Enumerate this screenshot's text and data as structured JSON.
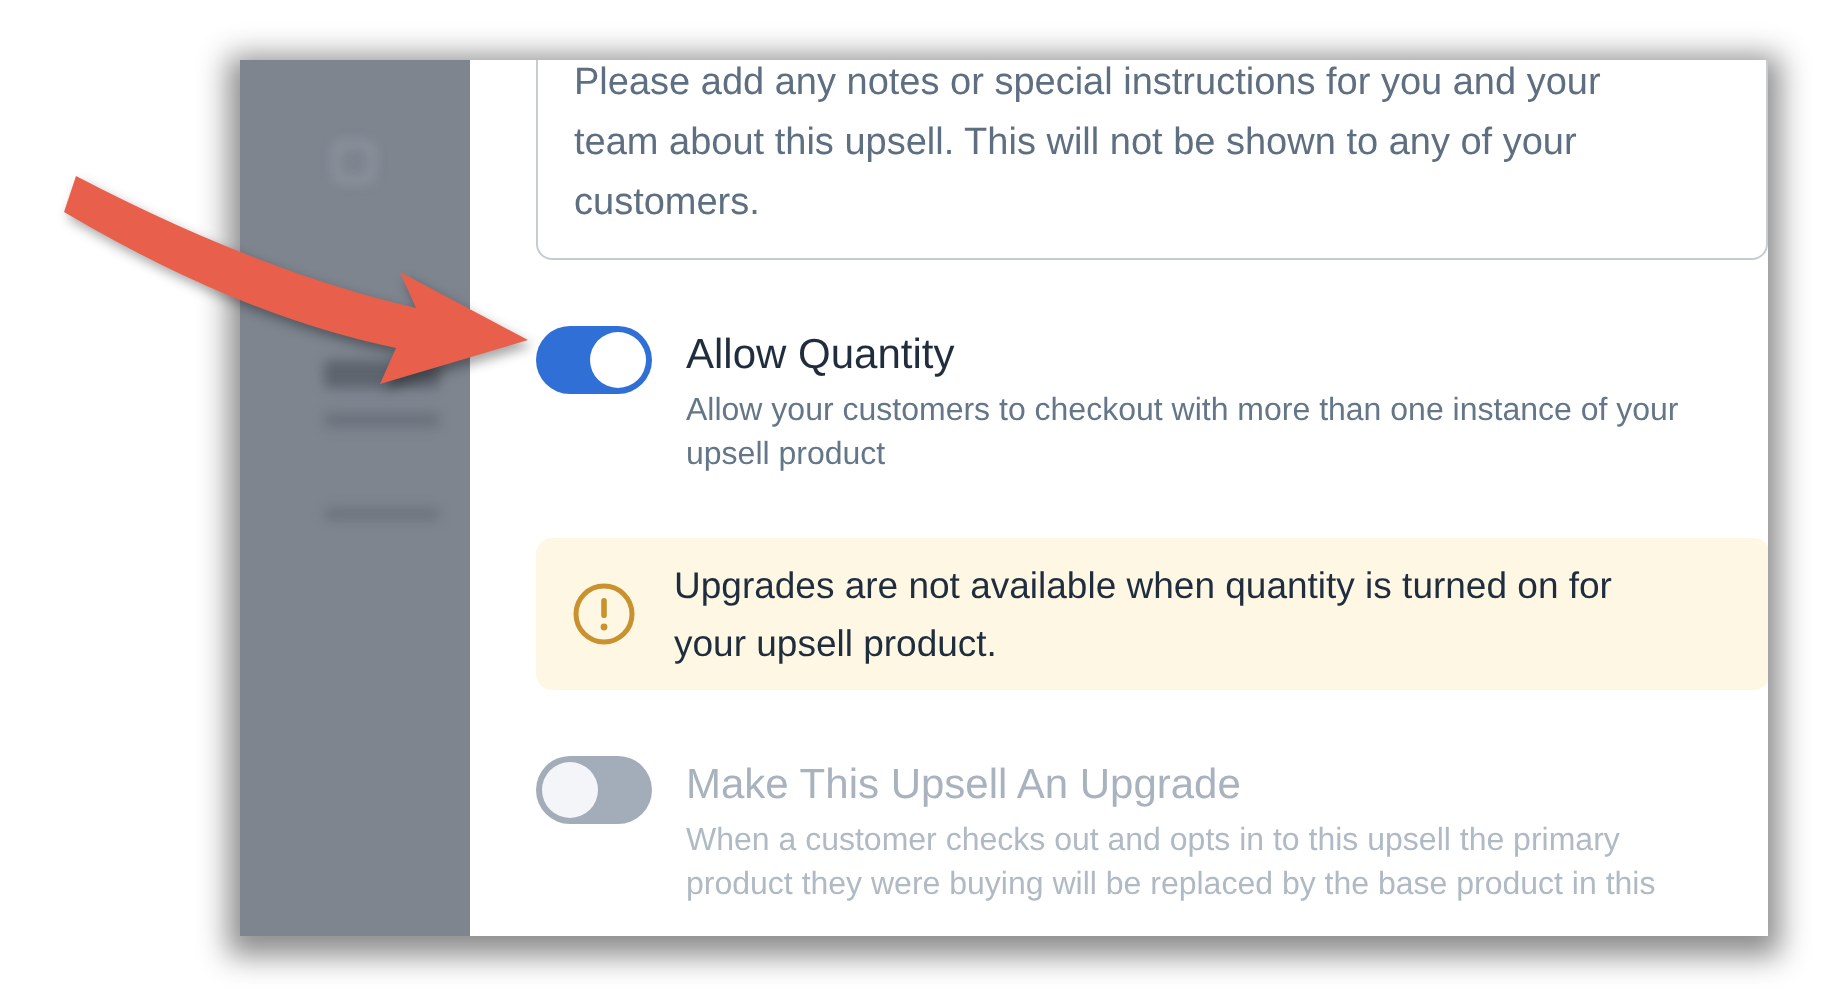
{
  "notes": {
    "value": "Please add any notes or special instructions for you and your team about this upsell. This will not be shown to any of your customers."
  },
  "settings": [
    {
      "kind": "toggle",
      "label": "Allow Quantity",
      "description": "Allow your customers to checkout with more than one instance of your upsell product",
      "on": true,
      "disabled": false
    },
    {
      "kind": "notice",
      "text": "Upgrades are not available when quantity is turned on for your upsell product."
    },
    {
      "kind": "toggle",
      "label": "Make This Upsell An Upgrade",
      "description": "When a customer checks out and opts in to this upsell the primary product they were buying will be replaced by the base product in this",
      "on": false,
      "disabled": true
    }
  ]
}
